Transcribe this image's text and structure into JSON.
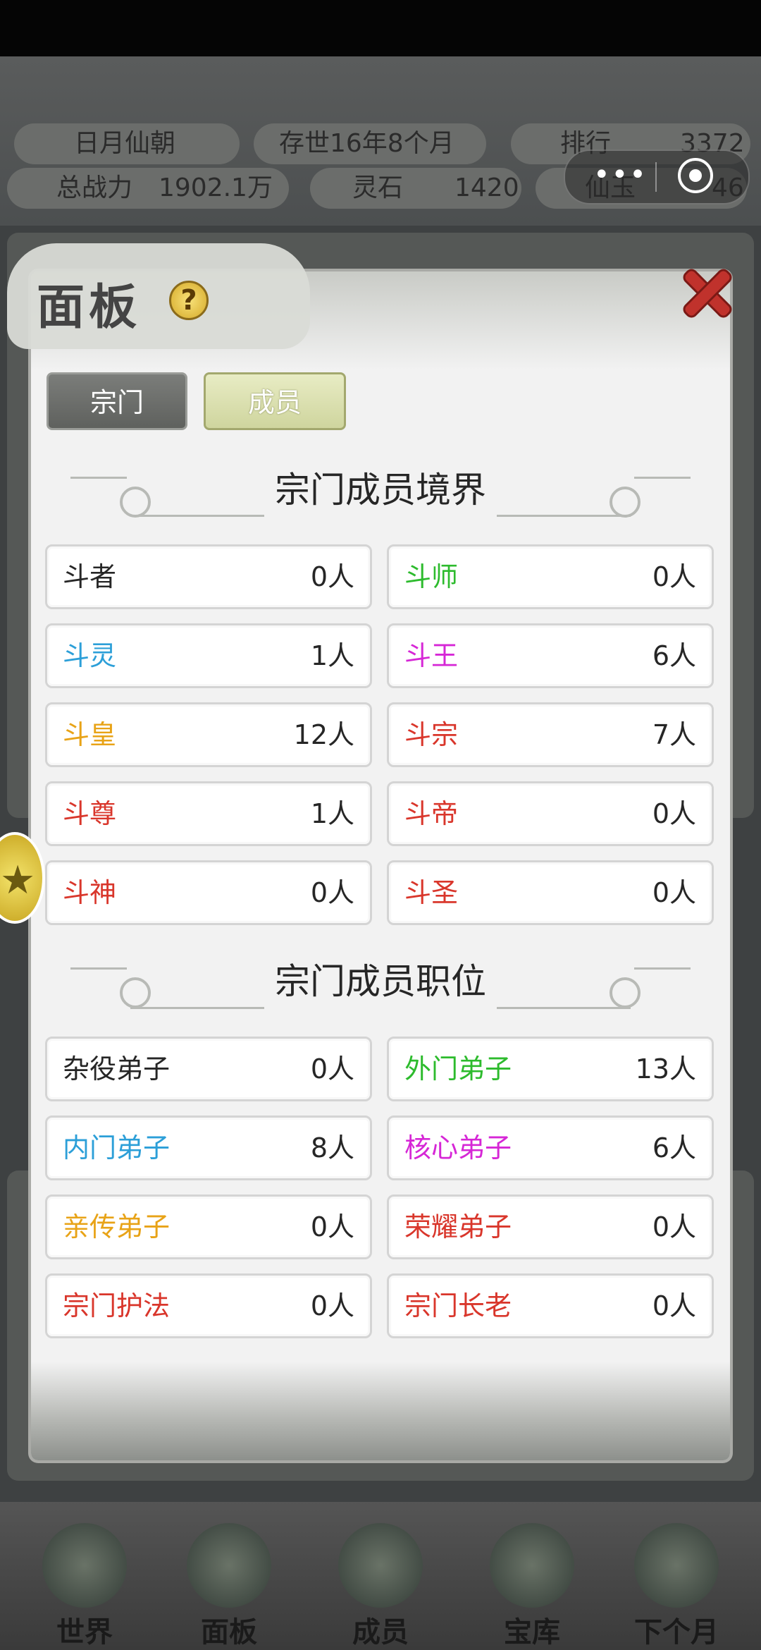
{
  "header": {
    "sect_name": "日月仙朝",
    "age": "存世16年8个月",
    "rank_label": "排行",
    "rank_value": "3372",
    "power_label": "总战力",
    "power_value": "1902.1万",
    "stone_label": "灵石",
    "stone_value": "1420",
    "jade_label": "仙玉",
    "jade_value": "46"
  },
  "panel": {
    "title": "面板",
    "help_symbol": "?",
    "tabs": [
      {
        "label": "宗门",
        "active": false
      },
      {
        "label": "成员",
        "active": true
      }
    ],
    "realm_title": "宗门成员境界",
    "realms": [
      {
        "name": "斗者",
        "count": "0人",
        "color": "#262626"
      },
      {
        "name": "斗师",
        "count": "0人",
        "color": "#2dbb2d"
      },
      {
        "name": "斗灵",
        "count": "1人",
        "color": "#2c9fd8"
      },
      {
        "name": "斗王",
        "count": "6人",
        "color": "#d627d6"
      },
      {
        "name": "斗皇",
        "count": "12人",
        "color": "#e8a317"
      },
      {
        "name": "斗宗",
        "count": "7人",
        "color": "#d9362b"
      },
      {
        "name": "斗尊",
        "count": "1人",
        "color": "#d9362b"
      },
      {
        "name": "斗帝",
        "count": "0人",
        "color": "#d9362b"
      },
      {
        "name": "斗神",
        "count": "0人",
        "color": "#d9362b"
      },
      {
        "name": "斗圣",
        "count": "0人",
        "color": "#d9362b"
      }
    ],
    "position_title": "宗门成员职位",
    "positions": [
      {
        "name": "杂役弟子",
        "count": "0人",
        "color": "#262626"
      },
      {
        "name": "外门弟子",
        "count": "13人",
        "color": "#2dbb2d"
      },
      {
        "name": "内门弟子",
        "count": "8人",
        "color": "#2c9fd8"
      },
      {
        "name": "核心弟子",
        "count": "6人",
        "color": "#d627d6"
      },
      {
        "name": "亲传弟子",
        "count": "0人",
        "color": "#e8a317"
      },
      {
        "name": "荣耀弟子",
        "count": "0人",
        "color": "#d9362b"
      },
      {
        "name": "宗门护法",
        "count": "0人",
        "color": "#d9362b"
      },
      {
        "name": "宗门长老",
        "count": "0人",
        "color": "#d9362b"
      }
    ]
  },
  "nav": {
    "items": [
      {
        "label": "世界"
      },
      {
        "label": "面板"
      },
      {
        "label": "成员"
      },
      {
        "label": "宝库"
      },
      {
        "label": "下个月"
      }
    ]
  },
  "icons": {
    "capsule_more": "more-dots-icon",
    "capsule_close": "target-ring-icon",
    "close": "close-x-icon",
    "side": "star-badge-icon"
  }
}
